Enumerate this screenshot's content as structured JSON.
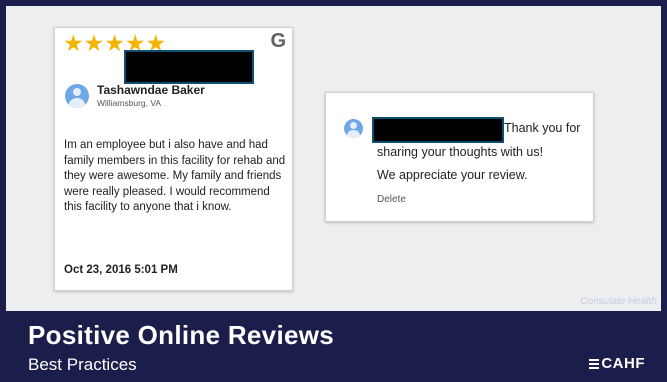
{
  "review": {
    "stars": "★★★★★",
    "google_icon": "G",
    "reviewer_name": "Tashawndae Baker",
    "reviewer_location": "Williamsburg, VA",
    "text": "Im an employee but i also have and had family members in this facility for rehab and they were awesome. My family and friends were really pleased. I would recommend this facility to anyone that i know.",
    "date": "Oct 23, 2016 5:01 PM"
  },
  "reply": {
    "line1": "Thank you for",
    "line2": "sharing your thoughts with us!",
    "line3": "We appreciate your review.",
    "delete_label": "Delete"
  },
  "watermark": "Consulate Health",
  "footer": {
    "title": "Positive Online Reviews",
    "subtitle": "Best Practices",
    "logo_text": "CAHF"
  },
  "colors": {
    "footer_bg": "#1b1d4a",
    "star": "#f4b400",
    "avatar": "#6ea6e6"
  }
}
